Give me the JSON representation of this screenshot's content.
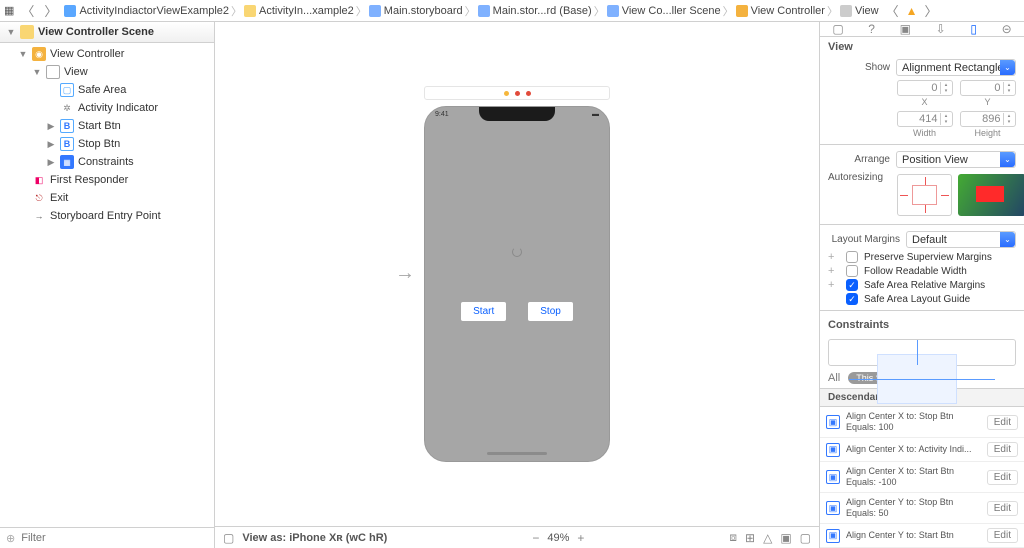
{
  "breadcrumbs": {
    "items": [
      {
        "icon": "swift",
        "label": "ActivityIndiactorViewExample2"
      },
      {
        "icon": "folder",
        "label": "ActivityIn...xample2"
      },
      {
        "icon": "storyboard",
        "label": "Main.storyboard"
      },
      {
        "icon": "storyboard",
        "label": "Main.stor...rd (Base)"
      },
      {
        "icon": "scene",
        "label": "View Co...ller Scene"
      },
      {
        "icon": "vc",
        "label": "View Controller"
      },
      {
        "icon": "view",
        "label": "View"
      }
    ]
  },
  "outline": {
    "title": "View Controller Scene",
    "rows": [
      {
        "indent": 1,
        "tw": "▼",
        "icon": "vc",
        "label": "View Controller"
      },
      {
        "indent": 2,
        "tw": "▼",
        "icon": "view",
        "label": "View"
      },
      {
        "indent": 3,
        "tw": "",
        "icon": "safe",
        "label": "Safe Area"
      },
      {
        "indent": 3,
        "tw": "",
        "icon": "act",
        "label": "Activity Indicator"
      },
      {
        "indent": 3,
        "tw": "▶",
        "icon": "btn",
        "label": "Start Btn"
      },
      {
        "indent": 3,
        "tw": "▶",
        "icon": "btn",
        "label": "Stop Btn"
      },
      {
        "indent": 3,
        "tw": "▶",
        "icon": "cons",
        "label": "Constraints"
      },
      {
        "indent": 1,
        "tw": "",
        "icon": "first",
        "label": "First Responder"
      },
      {
        "indent": 1,
        "tw": "",
        "icon": "exit",
        "label": "Exit"
      },
      {
        "indent": 1,
        "tw": "",
        "icon": "entry",
        "label": "Storyboard Entry Point"
      }
    ],
    "filter_placeholder": "Filter"
  },
  "canvas": {
    "status_time": "9:41",
    "btn_start": "Start",
    "btn_stop": "Stop",
    "footer_device": "View as: iPhone Xʀ (wC hR)",
    "zoom": "49%"
  },
  "inspector": {
    "title": "View",
    "show_label": "Show",
    "show_value": "Alignment Rectangle",
    "x": {
      "value": "0",
      "label": "X"
    },
    "y": {
      "value": "0",
      "label": "Y"
    },
    "w": {
      "value": "414",
      "label": "Width"
    },
    "h": {
      "value": "896",
      "label": "Height"
    },
    "arrange_label": "Arrange",
    "arrange_value": "Position View",
    "autoresize_label": "Autoresizing",
    "layout_margins_label": "Layout Margins",
    "layout_margins_value": "Default",
    "checks": [
      {
        "on": false,
        "label": "Preserve Superview Margins"
      },
      {
        "on": false,
        "label": "Follow Readable Width"
      },
      {
        "on": true,
        "label": "Safe Area Relative Margins"
      },
      {
        "on": true,
        "label": "Safe Area Layout Guide"
      }
    ],
    "constraints_label": "Constraints",
    "all_label": "All",
    "size_class_label": "This Size Class",
    "descendant_title": "Descendant Constraints",
    "descendant": [
      {
        "l1": "Align Center X to:  Stop Btn",
        "l2": "Equals:  100"
      },
      {
        "l1": "Align Center X to:  Activity Indi...",
        "l2": ""
      },
      {
        "l1": "Align Center X to:  Start Btn",
        "l2": "Equals:  -100"
      },
      {
        "l1": "Align Center Y to:  Stop Btn",
        "l2": "Equals:  50"
      },
      {
        "l1": "Align Center Y to:  Start Btn",
        "l2": ""
      }
    ],
    "edit_label": "Edit"
  }
}
